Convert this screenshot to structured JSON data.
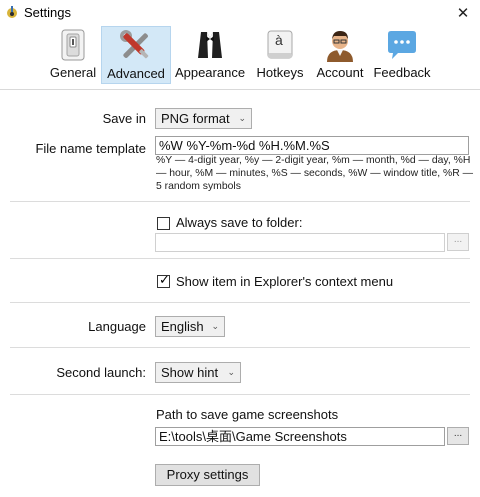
{
  "window": {
    "title": "Settings",
    "close_glyph": "✕"
  },
  "toolbar": {
    "items": [
      {
        "label": "General",
        "icon": "switch-icon"
      },
      {
        "label": "Advanced",
        "icon": "tools-icon",
        "active": true
      },
      {
        "label": "Appearance",
        "icon": "tuxedo-icon"
      },
      {
        "label": "Hotkeys",
        "icon": "keyboard-key-icon"
      },
      {
        "label": "Account",
        "icon": "user-icon"
      },
      {
        "label": "Feedback",
        "icon": "chat-bubble-icon"
      }
    ],
    "key_glyph": "à"
  },
  "save_in": {
    "label": "Save in",
    "value": "PNG format"
  },
  "file_name_template": {
    "label": "File name template",
    "value": "%W %Y-%m-%d %H.%M.%S",
    "hint": "%Y — 4-digit year, %y — 2-digit year, %m — month, %d — day, %H — hour, %M — minutes, %S — seconds, %W — window title, %R — 5 random symbols"
  },
  "always_save": {
    "label": "Always save to folder:",
    "checked": false,
    "path": "",
    "browse": "..."
  },
  "context_menu": {
    "label": "Show item in Explorer's context menu",
    "checked": true,
    "check_glyph": "✓"
  },
  "language": {
    "label": "Language",
    "value": "English"
  },
  "second_launch": {
    "label": "Second launch:",
    "value": "Show hint"
  },
  "game_path": {
    "label": "Path to save game screenshots",
    "value": "E:\\tools\\桌面\\Game Screenshots",
    "browse": "..."
  },
  "proxy": {
    "label": "Proxy settings"
  },
  "combo_arrow": "⌄",
  "colors": {
    "active_tab_bg": "#d3e8f7",
    "accent": "#5ba7e2"
  }
}
